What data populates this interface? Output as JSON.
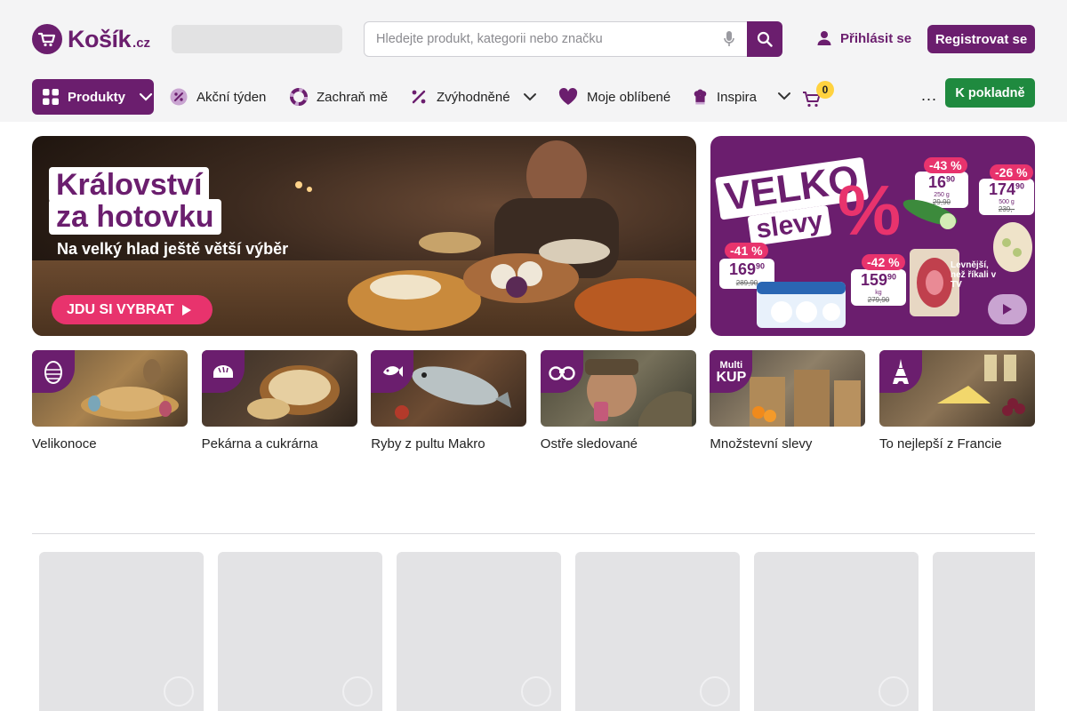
{
  "brand": {
    "name": "Košík",
    "tld": ".cz",
    "color": "#6b1e6e",
    "accent": "#e8336d",
    "green": "#1f8a3f"
  },
  "header": {
    "search": {
      "placeholder": "Hledejte produkt, kategorii nebo značku",
      "value": ""
    },
    "login_label": "Přihlásit se",
    "register_label": "Registrovat se"
  },
  "nav": {
    "products_label": "Produkty",
    "items": [
      {
        "label": "Akční týden",
        "icon": "percent-badge-icon"
      },
      {
        "label": "Zachraň mě",
        "icon": "lifebuoy-icon"
      },
      {
        "label": "Zvýhodněné",
        "icon": "percent-icon"
      },
      {
        "label": "Moje oblíbené",
        "icon": "heart-icon"
      },
      {
        "label": "Inspira",
        "icon": "chef-icon"
      }
    ],
    "cart_count": "0",
    "more_label": "...",
    "checkout_label": "K pokladně"
  },
  "banners": {
    "main": {
      "headline_1": "Království",
      "headline_2": "za hotovku",
      "subtitle": "Na velký hlad ještě větší výběr",
      "cta": "JDU SI VYBRAT"
    },
    "side": {
      "title_1": "VELKO",
      "title_2": "slevy",
      "percent_sign": "%",
      "offers": [
        {
          "discount": "-43 %",
          "price": "16",
          "cents": "90",
          "unit": "250 g",
          "old": "29,90"
        },
        {
          "discount": "-26 %",
          "price": "174",
          "cents": "90",
          "unit": "500 g",
          "old": "239,-"
        },
        {
          "discount": "-41 %",
          "price": "169",
          "cents": "90",
          "unit": "",
          "old": "289,90"
        },
        {
          "discount": "-42 %",
          "price": "159",
          "cents": "90",
          "unit": "kg",
          "old": "279,90"
        }
      ],
      "tv_note": "Levnější, než říkali v TV"
    }
  },
  "categories": [
    {
      "label": "Velikonoce",
      "icon": "easter-egg-icon"
    },
    {
      "label": "Pekárna a cukrárna",
      "icon": "bread-icon"
    },
    {
      "label": "Ryby z pultu Makro",
      "icon": "fish-icon"
    },
    {
      "label": "Ostře sledované",
      "icon": "binoculars-icon"
    },
    {
      "label": "Množstevní slevy",
      "icon": "multikup-icon",
      "corner_text_1": "Multi",
      "corner_text_2": "KUP"
    },
    {
      "label": "To nejlepší z Francie",
      "icon": "eiffel-tower-icon"
    }
  ]
}
